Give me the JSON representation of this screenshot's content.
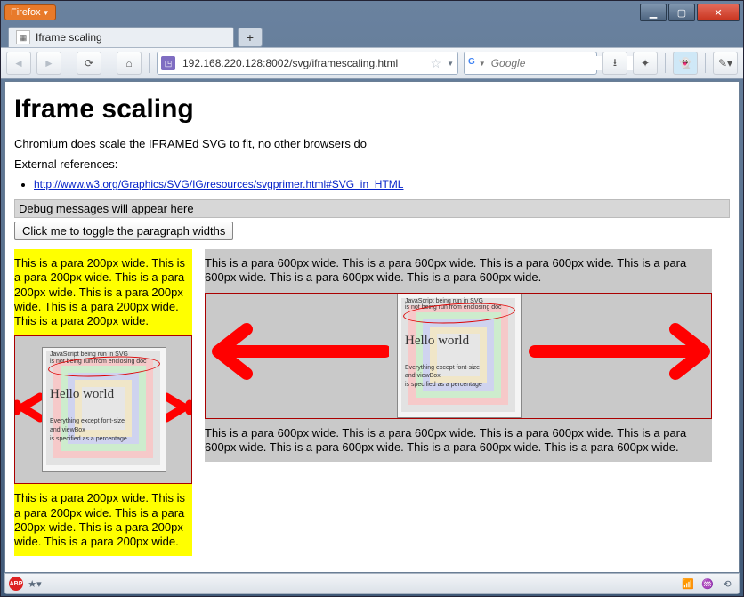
{
  "chrome": {
    "menu_label": "Firefox",
    "tab_title": "Iframe scaling",
    "url": "192.168.220.128:8002/svg/iframescaling.html",
    "search_placeholder": "Google"
  },
  "page": {
    "heading": "Iframe scaling",
    "intro": "Chromium does scale the IFRAMEd SVG to fit, no other browsers do",
    "external_label": "External references:",
    "external_link": "http://www.w3.org/Graphics/SVG/IG/resources/svgprimer.html#SVG_in_HTML",
    "debug_text": "Debug messages will appear here",
    "button_label": "Click me to toggle the paragraph widths",
    "para200": "This is a para 200px wide. This is a para 200px wide. This is a para 200px wide. This is a para 200px wide. This is a para 200px wide. This is a para 200px wide.",
    "para200b": "This is a para 200px wide. This is a para 200px wide. This is a para 200px wide. This is a para 200px wide. This is a para 200px wide.",
    "para600": "This is a para 600px wide. This is a para 600px wide. This is a para 600px wide. This is a para 600px wide. This is a para 600px wide. This is a para 600px wide.",
    "para600b": "This is a para 600px wide. This is a para 600px wide. This is a para 600px wide. This is a para 600px wide. This is a para 600px wide. This is a para 600px wide. This is a para 600px wide."
  },
  "svg": {
    "line1": "JavaScript being run in SVG",
    "line2": "is not being run from enclosing doc",
    "hello": "Hello world",
    "line3": "Everything except font-size",
    "line4": "and viewBox",
    "line5": "is specified as a percentage"
  }
}
